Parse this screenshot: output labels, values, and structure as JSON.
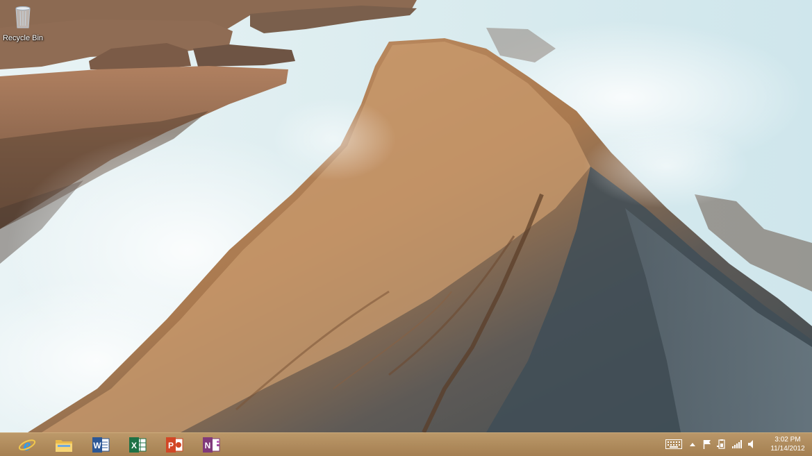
{
  "desktop": {
    "icons": [
      {
        "label": "Recycle Bin",
        "icon": "recycle-bin-icon"
      }
    ]
  },
  "taskbar": {
    "pinned_apps": [
      {
        "name": "Internet Explorer",
        "icon": "internet-explorer-icon",
        "color": "#1e90ff"
      },
      {
        "name": "File Explorer",
        "icon": "file-explorer-icon",
        "color": "#f2c94c"
      },
      {
        "name": "Word",
        "icon": "word-icon",
        "color": "#2b5797"
      },
      {
        "name": "Excel",
        "icon": "excel-icon",
        "color": "#1e7145"
      },
      {
        "name": "PowerPoint",
        "icon": "powerpoint-icon",
        "color": "#d24726"
      },
      {
        "name": "OneNote",
        "icon": "onenote-icon",
        "color": "#80397b"
      }
    ],
    "tray": {
      "icons": [
        "keyboard-icon",
        "show-hidden-icons-chevron",
        "action-center-flag-icon",
        "power-icon",
        "network-signal-icon",
        "volume-icon"
      ]
    },
    "clock": {
      "time": "3:02 PM",
      "date": "11/14/2012"
    }
  },
  "colors": {
    "taskbar": "#a9773f",
    "accent": "#1e90ff"
  }
}
